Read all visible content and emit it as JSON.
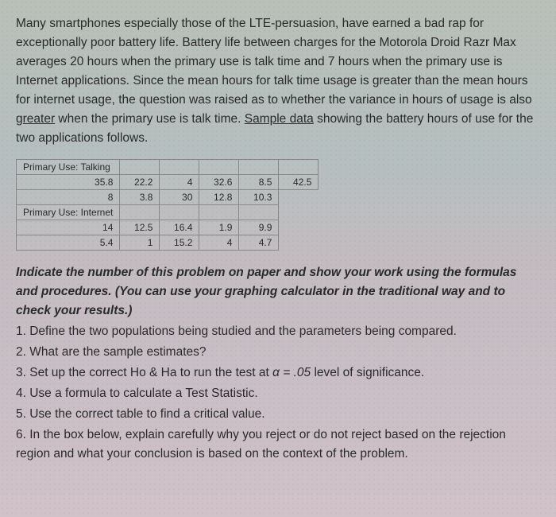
{
  "intro": {
    "line1": "Many smartphones especially those of the LTE-persuasion, have earned a bad rap for exceptionally poor battery life. Battery life between charges for the Motorola Droid Razr Max averages 20 hours when the primary use is talk time and 7 hours when the primary use is Internet applications. Since the mean hours for talk time usage is greater than the mean hours for internet usage, the question was raised as to whether the variance in hours of usage is also ",
    "underlined1": "greater",
    "mid": " when the primary use is talk time. ",
    "underlined2": "Sample data",
    "line2": " showing the battery hours of use for the two applications follows."
  },
  "table": {
    "header1": "Primary Use: Talking",
    "row1": [
      "35.8",
      "22.2",
      "4",
      "32.6",
      "8.5",
      "42.5"
    ],
    "row2": [
      "8",
      "3.8",
      "30",
      "12.8",
      "10.3",
      ""
    ],
    "header2": "Primary Use: Internet",
    "row3": [
      "14",
      "12.5",
      "16.4",
      "1.9",
      "9.9",
      ""
    ],
    "row4": [
      "5.4",
      "1",
      "15.2",
      "4",
      "4.7",
      ""
    ]
  },
  "instructions": {
    "lead": "Indicate the number of this problem on paper and show your work using the formulas and procedures. (You can use your graphing calculator in the traditional way and to check your results.)",
    "q1": "1. Define the two populations being studied and the parameters being compared.",
    "q2": "2. What are the sample estimates?",
    "q3a": "3. Set up the correct Ho & Ha to run the test at ",
    "alpha": "α = .05",
    "q3b": " level of significance.",
    "q4": "4. Use a formula to calculate a Test Statistic.",
    "q5": "5. Use the correct table to find a critical value.",
    "q6": "6. In the box below, explain carefully why you reject or do not reject based on the rejection region and what your conclusion is based on the context of the problem."
  }
}
